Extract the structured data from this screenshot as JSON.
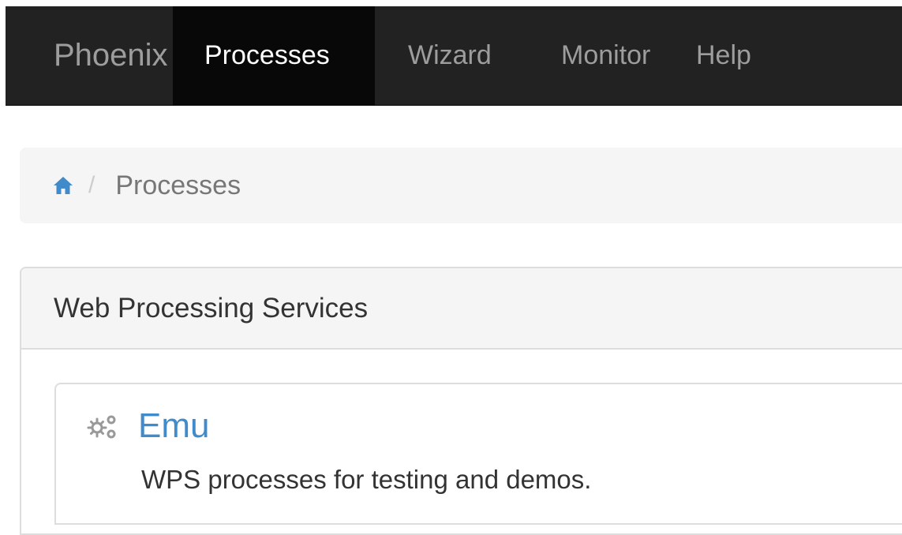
{
  "navbar": {
    "brand": "Phoenix",
    "items": [
      {
        "label": "Processes",
        "active": true
      },
      {
        "label": "Wizard",
        "active": false
      },
      {
        "label": "Monitor",
        "active": false
      },
      {
        "label": "Help",
        "active": false
      }
    ]
  },
  "breadcrumb": {
    "home_icon": "home-icon",
    "separator": "/",
    "current": "Processes"
  },
  "panel": {
    "title": "Web Processing Services",
    "services": [
      {
        "icon": "cogs-icon",
        "title": "Emu",
        "description": "WPS processes for testing and demos."
      }
    ]
  },
  "colors": {
    "navbar_bg": "#222222",
    "navbar_active_bg": "#080808",
    "link": "#428bca",
    "breadcrumb_bg": "#f5f5f5"
  }
}
